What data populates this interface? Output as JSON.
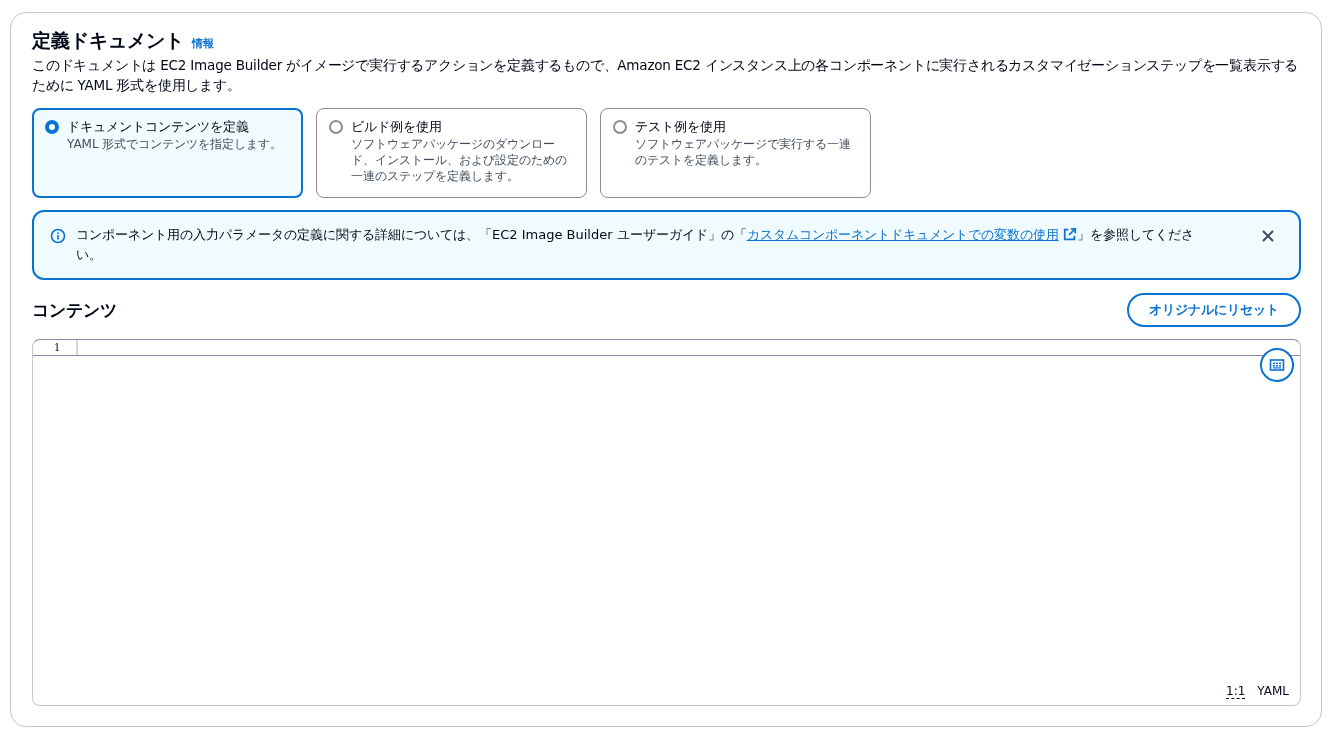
{
  "section": {
    "title": "定義ドキュメント",
    "info_link": "情報",
    "description": "このドキュメントは EC2 Image Builder がイメージで実行するアクションを定義するもので、Amazon EC2 インスタンス上の各コンポーネントに実行されるカスタマイゼーションステップを一覧表示するために YAML 形式を使用します。"
  },
  "options": [
    {
      "label": "ドキュメントコンテンツを定義",
      "description": "YAML 形式でコンテンツを指定します。",
      "selected": true
    },
    {
      "label": "ビルド例を使用",
      "description": "ソフトウェアパッケージのダウンロード、インストール、および設定のための一連のステップを定義します。",
      "selected": false
    },
    {
      "label": "テスト例を使用",
      "description": "ソフトウェアパッケージで実行する一連のテストを定義します。",
      "selected": false
    }
  ],
  "alert": {
    "text_before": "コンポーネント用の入力パラメータの定義に関する詳細については、「EC2 Image Builder ユーザーガイド」の「",
    "link": "カスタムコンポーネントドキュメントでの変数の使用",
    "text_after": "」を参照してください。"
  },
  "editor": {
    "title": "コンテンツ",
    "reset_button": "オリジナルにリセット",
    "line_numbers": [
      "1"
    ],
    "cursor_position": "1:1",
    "language": "YAML"
  }
}
